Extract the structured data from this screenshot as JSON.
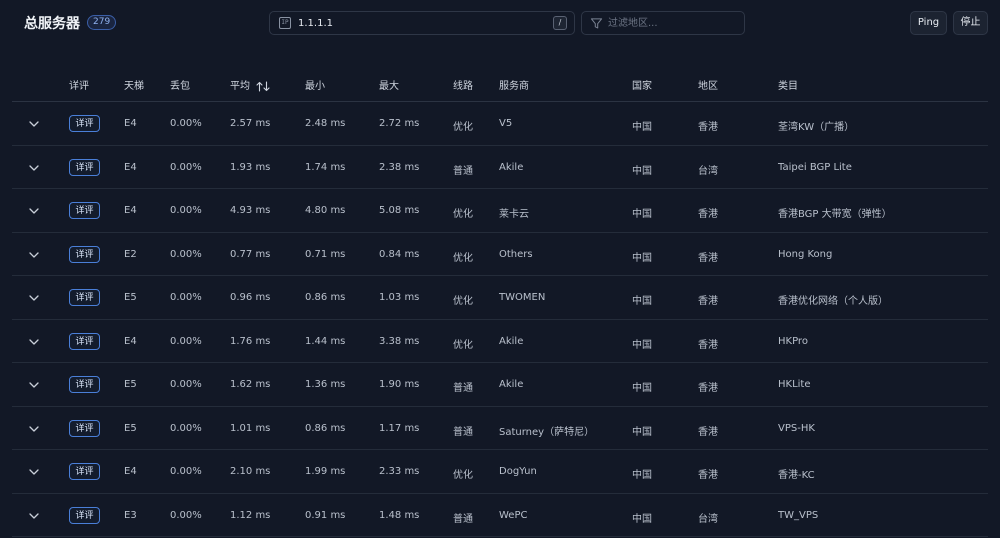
{
  "header": {
    "title": "总服务器",
    "count": "279",
    "search": {
      "icon": "ip-icon",
      "icon_text": "IP",
      "value": "1.1.1.1",
      "shortcut": "/"
    },
    "filter": {
      "icon": "filter-icon",
      "placeholder": "过滤地区..."
    },
    "ping_label": "Ping",
    "stop_label": "停止"
  },
  "columns": {
    "detail": "详评",
    "tier": "天梯",
    "loss": "丢包",
    "avg": "平均",
    "min": "最小",
    "max": "最大",
    "route": "线路",
    "isp": "服务商",
    "country": "国家",
    "region": "地区",
    "category": "类目"
  },
  "detail_label": "详评",
  "rows": [
    {
      "tier": "E4",
      "loss": "0.00%",
      "avg": "2.57 ms",
      "min": "2.48 ms",
      "max": "2.72 ms",
      "route": "优化",
      "isp": "V5",
      "country": "中国",
      "region": "香港",
      "category": "荃湾KW（广播）"
    },
    {
      "tier": "E4",
      "loss": "0.00%",
      "avg": "1.93 ms",
      "min": "1.74 ms",
      "max": "2.38 ms",
      "route": "普通",
      "isp": "Akile",
      "country": "中国",
      "region": "台湾",
      "category": "Taipei BGP Lite"
    },
    {
      "tier": "E4",
      "loss": "0.00%",
      "avg": "4.93 ms",
      "min": "4.80 ms",
      "max": "5.08 ms",
      "route": "优化",
      "isp": "莱卡云",
      "country": "中国",
      "region": "香港",
      "category": "香港BGP 大带宽（弹性）"
    },
    {
      "tier": "E2",
      "loss": "0.00%",
      "avg": "0.77 ms",
      "min": "0.71 ms",
      "max": "0.84 ms",
      "route": "优化",
      "isp": "Others",
      "country": "中国",
      "region": "香港",
      "category": "Hong Kong"
    },
    {
      "tier": "E5",
      "loss": "0.00%",
      "avg": "0.96 ms",
      "min": "0.86 ms",
      "max": "1.03 ms",
      "route": "优化",
      "isp": "TWOMEN",
      "country": "中国",
      "region": "香港",
      "category": "香港优化网络（个人版）"
    },
    {
      "tier": "E4",
      "loss": "0.00%",
      "avg": "1.76 ms",
      "min": "1.44 ms",
      "max": "3.38 ms",
      "route": "优化",
      "isp": "Akile",
      "country": "中国",
      "region": "香港",
      "category": "HKPro"
    },
    {
      "tier": "E5",
      "loss": "0.00%",
      "avg": "1.62 ms",
      "min": "1.36 ms",
      "max": "1.90 ms",
      "route": "普通",
      "isp": "Akile",
      "country": "中国",
      "region": "香港",
      "category": "HKLite"
    },
    {
      "tier": "E5",
      "loss": "0.00%",
      "avg": "1.01 ms",
      "min": "0.86 ms",
      "max": "1.17 ms",
      "route": "普通",
      "isp": "Saturney（萨特尼）",
      "country": "中国",
      "region": "香港",
      "category": "VPS-HK"
    },
    {
      "tier": "E4",
      "loss": "0.00%",
      "avg": "2.10 ms",
      "min": "1.99 ms",
      "max": "2.33 ms",
      "route": "优化",
      "isp": "DogYun",
      "country": "中国",
      "region": "香港",
      "category": "香港-KC"
    },
    {
      "tier": "E3",
      "loss": "0.00%",
      "avg": "1.12 ms",
      "min": "0.91 ms",
      "max": "1.48 ms",
      "route": "普通",
      "isp": "WePC",
      "country": "中国",
      "region": "台湾",
      "category": "TW_VPS"
    }
  ],
  "colors": {
    "background": "#121826",
    "accent": "#4a7fd8",
    "border": "#2b3342"
  }
}
